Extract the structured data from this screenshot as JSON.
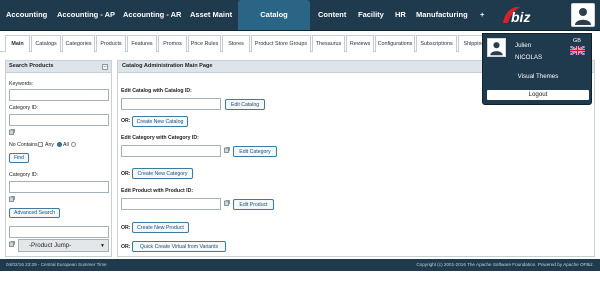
{
  "topnav": {
    "items": [
      "Accounting",
      "Accounting - AP",
      "Accounting - AR",
      "Asset Maint",
      "Catalog",
      "Content",
      "Facility",
      "HR",
      "Manufacturing",
      "+"
    ],
    "active": "Catalog",
    "logo_text": "OFbiz"
  },
  "subtabs": {
    "items": [
      "Main",
      "Catalogs",
      "Categories",
      "Products",
      "Features",
      "Promos",
      "Price Rules",
      "Stores",
      "Product Store Groups",
      "Thesaurus",
      "Reviews",
      "Configurations",
      "Subscriptions",
      "Shipping"
    ],
    "active": "Main"
  },
  "search": {
    "title": "Search Products",
    "collapse_icon": "minus",
    "keywords_label": "Keywords:",
    "category_id_label": "Category ID:",
    "no_contains_label": "No Contains",
    "any_label": "Any",
    "all_label": "All",
    "find_button": "Find",
    "category_id_label_2": "Category ID:",
    "advanced_search_button": "Advanced Search",
    "product_jump": "-Product Jump-"
  },
  "main": {
    "title": "Catalog Administration Main Page",
    "edit_catalog_label": "Edit Catalog with Catalog ID:",
    "edit_catalog_button": "Edit Catalog",
    "or_label": "OR:",
    "create_catalog_button": "Create New Catalog",
    "edit_category_label": "Edit Category with Category ID:",
    "edit_category_button": "Edit Category",
    "create_category_button": "Create New Category",
    "edit_product_label": "Edit Product with Product ID:",
    "edit_product_button": "Edit Product",
    "create_product_button": "Create New Product",
    "quick_virtual_button": "Quick Create Virtual from Variants"
  },
  "user": {
    "first_name": "Julien",
    "last_name": "NICOLAS",
    "lang_code": "GB",
    "visual_themes": "Visual Themes",
    "logout": "Logout"
  },
  "footer": {
    "left": "04/02/16 23:29 - Central European Summer Time",
    "right": "Copyright (c) 2001-2016 The Apache Software Foundation. Powered by Apache OFBiz."
  },
  "colors": {
    "nav_bg": "#1f3a4d",
    "active_tab": "#2b6585",
    "logo_red": "#d6232a"
  }
}
